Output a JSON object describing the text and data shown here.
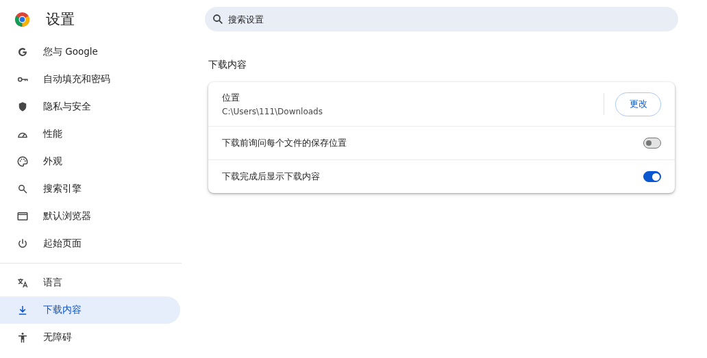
{
  "header": {
    "title": "设置"
  },
  "search": {
    "placeholder": "搜索设置"
  },
  "sidebar": {
    "groups": [
      [
        {
          "label": "您与 Google",
          "selected": false
        },
        {
          "label": "自动填充和密码",
          "selected": false
        },
        {
          "label": "隐私与安全",
          "selected": false
        },
        {
          "label": "性能",
          "selected": false
        },
        {
          "label": "外观",
          "selected": false
        },
        {
          "label": "搜索引擎",
          "selected": false
        },
        {
          "label": "默认浏览器",
          "selected": false
        },
        {
          "label": "起始页面",
          "selected": false
        }
      ],
      [
        {
          "label": "语言",
          "selected": false
        },
        {
          "label": "下载内容",
          "selected": true
        },
        {
          "label": "无障碍",
          "selected": false
        }
      ]
    ]
  },
  "section": {
    "title": "下载内容",
    "rows": [
      {
        "kind": "location",
        "label": "位置",
        "value": "C:\\Users\\111\\Downloads",
        "button": "更改"
      },
      {
        "kind": "toggle",
        "label": "下载前询问每个文件的保存位置",
        "on": false
      },
      {
        "kind": "toggle",
        "label": "下载完成后显示下载内容",
        "on": true
      }
    ]
  }
}
